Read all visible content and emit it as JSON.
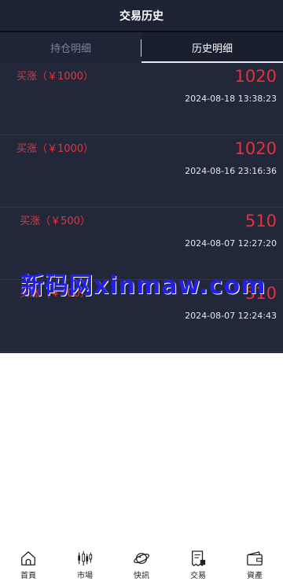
{
  "header": {
    "title": "交易历史"
  },
  "tabs": [
    {
      "label": "持仓明细",
      "active": false
    },
    {
      "label": "历史明细",
      "active": true
    }
  ],
  "records": [
    {
      "type": "买涨（￥1000）",
      "amount": "1020",
      "time": "2024-08-18 13:38:23"
    },
    {
      "type": "买涨（￥1000）",
      "amount": "1020",
      "time": "2024-08-16 23:16:36"
    },
    {
      "type": "买涨（￥500）",
      "amount": "510",
      "time": "2024-08-07 12:27:20"
    },
    {
      "type": "买涨（￥500）",
      "amount": "510",
      "time": "2024-08-07 12:24:43"
    }
  ],
  "watermark": "新码网xinmaw.com",
  "nav": [
    {
      "label": "首頁",
      "icon": "home-icon"
    },
    {
      "label": "市場",
      "icon": "candlestick-icon"
    },
    {
      "label": "快訊",
      "icon": "planet-icon"
    },
    {
      "label": "交易",
      "icon": "receipt-icon"
    },
    {
      "label": "資產",
      "icon": "wallet-icon"
    }
  ],
  "colors": {
    "background_dark": "#222739",
    "header": "#1d2234",
    "price_red": "#ea2f3c"
  }
}
